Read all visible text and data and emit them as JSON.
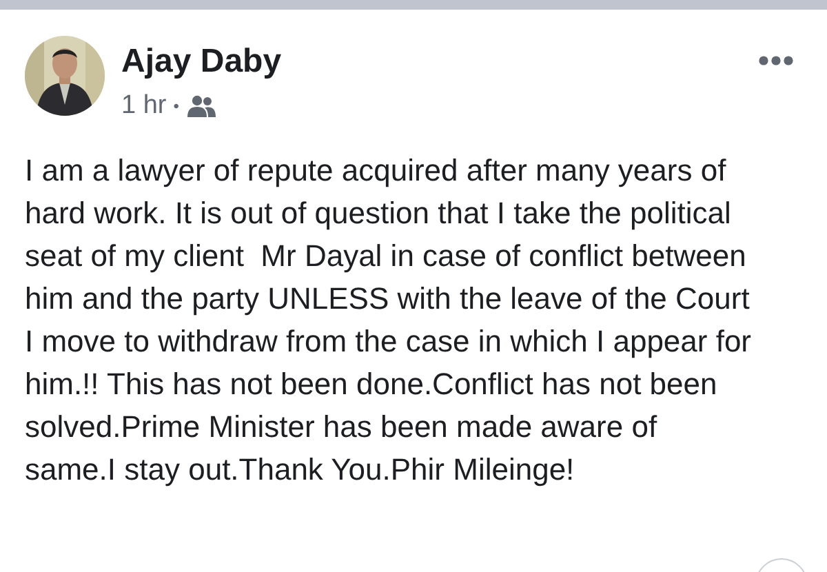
{
  "post": {
    "author": "Ajay Daby",
    "time": "1 hr",
    "separator": "•",
    "text": "I am a lawyer of repute acquired after many years of hard work. It is out of question that I take the political  seat of my client  Mr Dayal in case of conflict between him and the party UNLESS with the leave of the Court I move to withdraw from the case in which I appear for him.!! This has not been done.Conflict has not been solved.Prime Minister has been made aware of same.I stay out.Thank You.Phir Mileinge!"
  }
}
